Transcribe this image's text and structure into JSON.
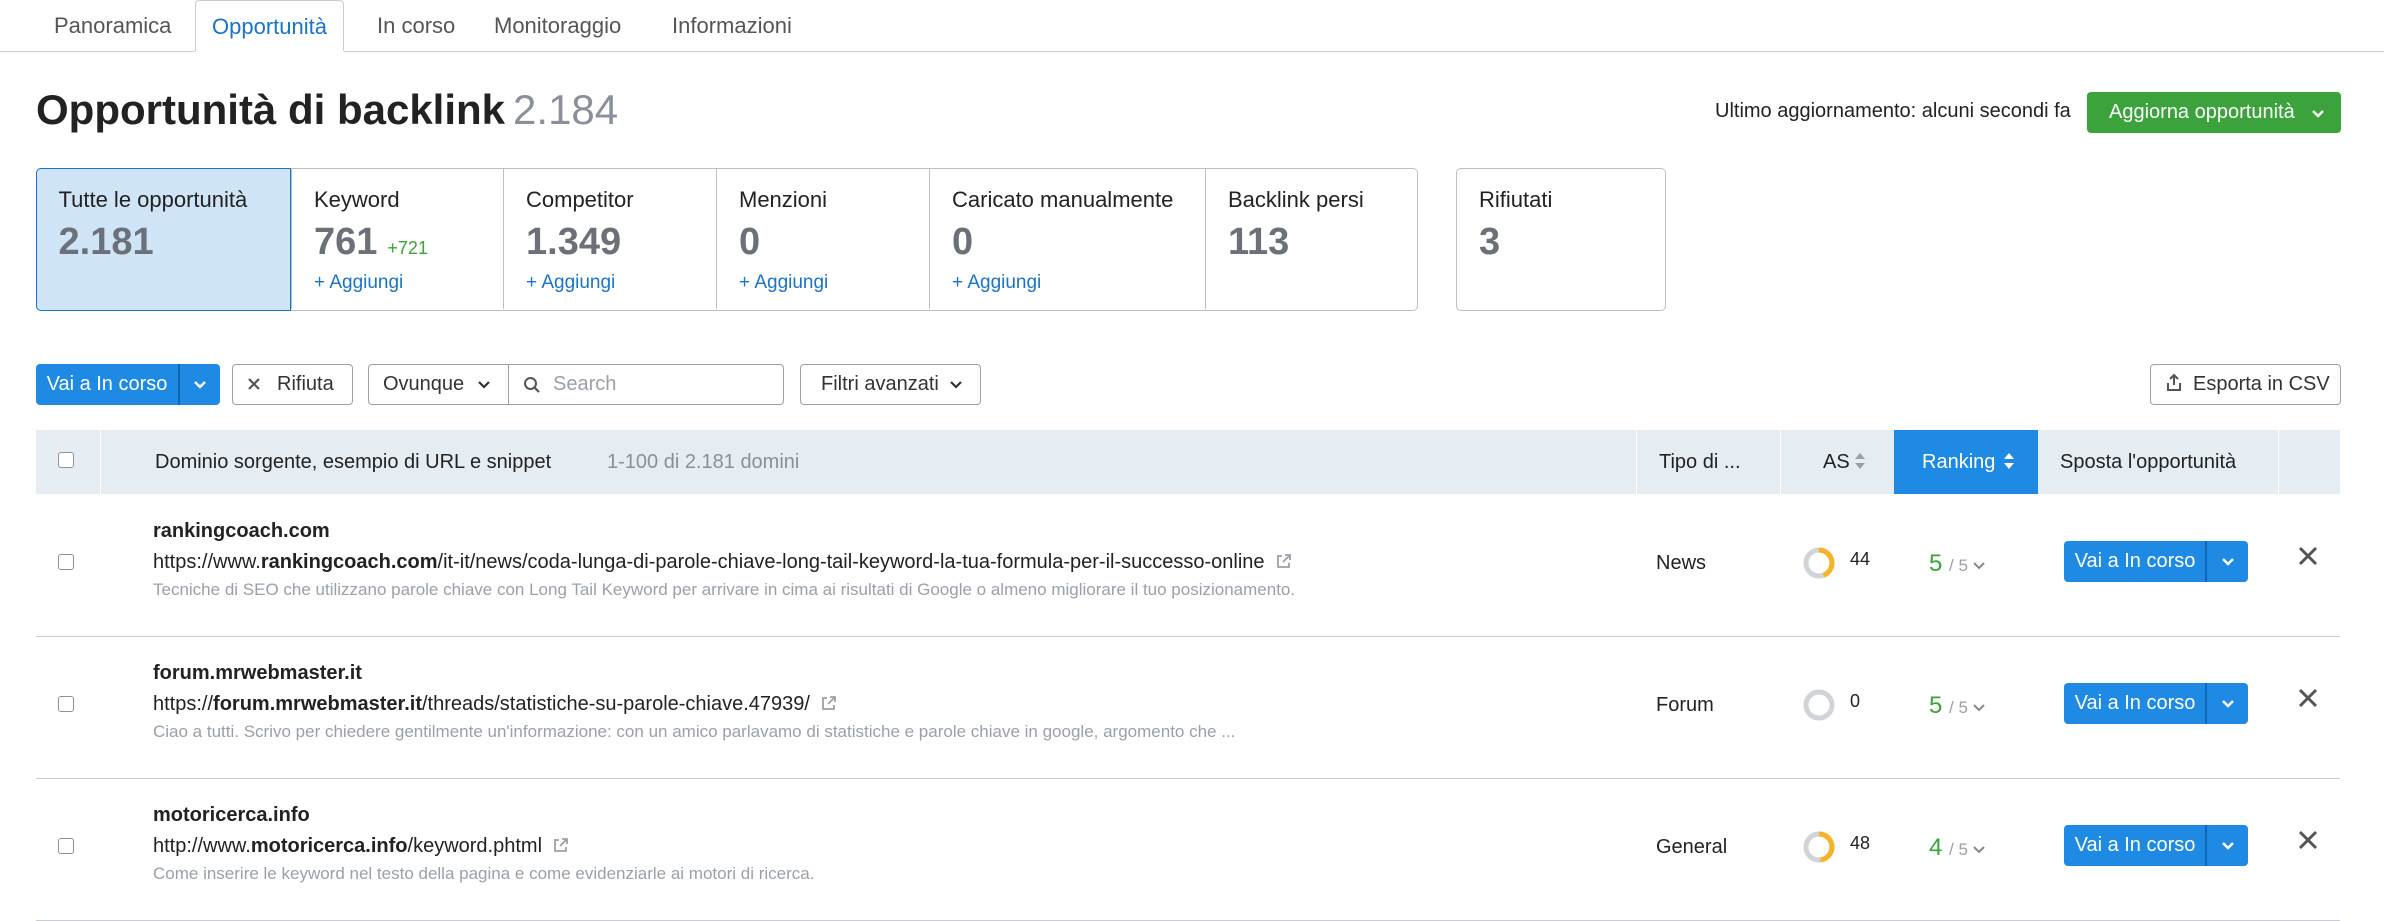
{
  "tabs": [
    "Panoramica",
    "Opportunità",
    "In corso",
    "Monitoraggio",
    "Informazioni"
  ],
  "header": {
    "title": "Opportunità di backlink",
    "count": "2.184",
    "last_update": "Ultimo aggiornamento: alcuni secondi fa",
    "update_button": "Aggiorna opportunità"
  },
  "cards": [
    {
      "label": "Tutte le opportunità",
      "value": "2.181",
      "delta": "",
      "add": ""
    },
    {
      "label": "Keyword",
      "value": "761",
      "delta": "+721",
      "add": "+ Aggiungi"
    },
    {
      "label": "Competitor",
      "value": "1.349",
      "delta": "",
      "add": "+ Aggiungi"
    },
    {
      "label": "Menzioni",
      "value": "0",
      "delta": "",
      "add": "+ Aggiungi"
    },
    {
      "label": "Caricato manualmente",
      "value": "0",
      "delta": "",
      "add": "+ Aggiungi"
    },
    {
      "label": "Backlink persi",
      "value": "113",
      "delta": "",
      "add": ""
    }
  ],
  "rejected_card": {
    "label": "Rifiutati",
    "value": "3"
  },
  "toolbar": {
    "go_button": "Vai a In corso",
    "reject_button": "Rifiuta",
    "location_select": "Ovunque",
    "search_placeholder": "Search",
    "advanced_filters": "Filtri avanzati",
    "export_button": "Esporta in CSV"
  },
  "table": {
    "col_source": "Dominio sorgente, esempio di URL e snippet",
    "range": "1-100 di 2.181 domini",
    "col_type": "Tipo di ...",
    "col_as": "AS",
    "col_ranking": "Ranking",
    "col_move": "Sposta l'opportunità",
    "rows": [
      {
        "domain": "rankingcoach.com",
        "url_prefix": "https://www.",
        "url_domain": "rankingcoach.com",
        "url_path": "/it-it/news/coda-lunga-di-parole-chiave-long-tail-keyword-la-tua-formula-per-il-successo-online",
        "snippet": "Tecniche di SEO che utilizzano parole chiave con Long Tail Keyword per arrivare in cima ai risultati di Google o almeno migliorare il tuo posizionamento.",
        "type": "News",
        "as": "44",
        "as_fraction": 0.44,
        "rank": "5",
        "rank_of": "/ 5",
        "action": "Vai a In corso"
      },
      {
        "domain": "forum.mrwebmaster.it",
        "url_prefix": "https://",
        "url_domain": "forum.mrwebmaster.it",
        "url_path": "/threads/statistiche-su-parole-chiave.47939/",
        "snippet": "Ciao a tutti. Scrivo per chiedere gentilmente un'informazione: con un amico parlavamo di statistiche e parole chiave in google, argomento che ...",
        "type": "Forum",
        "as": "0",
        "as_fraction": 0,
        "rank": "5",
        "rank_of": "/ 5",
        "action": "Vai a In corso"
      },
      {
        "domain": "motoricerca.info",
        "url_prefix": "http://www.",
        "url_domain": "motoricerca.info",
        "url_path": "/keyword.phtml",
        "snippet": "Come inserire le keyword nel testo della pagina e come evidenziarle ai motori di ricerca.",
        "type": "General",
        "as": "48",
        "as_fraction": 0.48,
        "rank": "4",
        "rank_of": "/ 5",
        "action": "Vai a In corso"
      }
    ]
  },
  "colors": {
    "accent": "#1f8ae3",
    "green": "#3ca23c",
    "donut": "#f5b428"
  }
}
